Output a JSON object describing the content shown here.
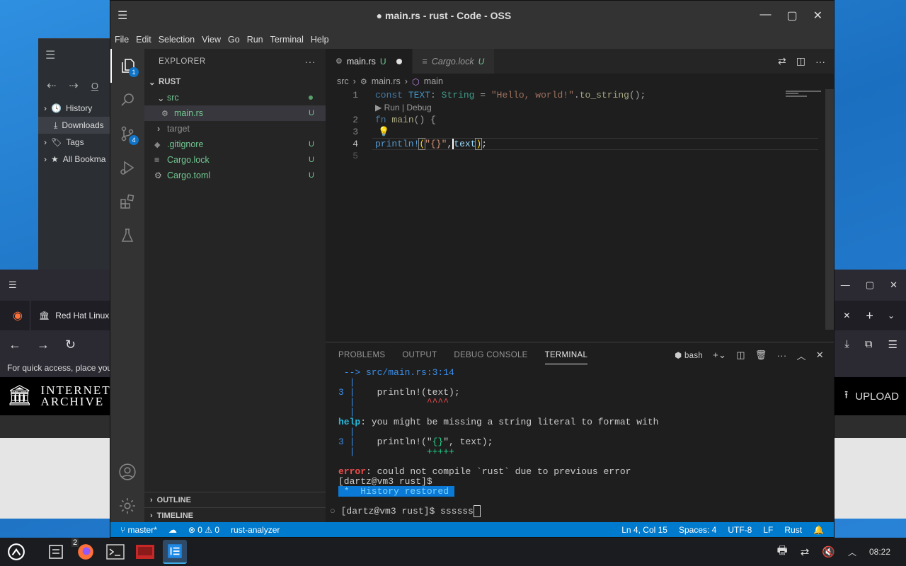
{
  "file_manager": {
    "places": [
      {
        "label": "History",
        "icon": "history-icon"
      },
      {
        "label": "Downloads",
        "icon": "download-icon"
      },
      {
        "label": "Tags",
        "icon": "tag-icon"
      },
      {
        "label": "All Bookma",
        "icon": "star-icon"
      }
    ],
    "nav_letter": "O"
  },
  "firefox": {
    "tab_title": "Red Hat Linux",
    "bookmarks_hint": "For quick access, place you",
    "logo_line1": "INTERNET",
    "logo_line2": "ARCHIVE",
    "upload_label": "UPLOAD"
  },
  "vscode": {
    "title": "main.rs - rust - Code - OSS",
    "menu": [
      "File",
      "Edit",
      "Selection",
      "View",
      "Go",
      "Run",
      "Terminal",
      "Help"
    ],
    "activity_badges": {
      "explorer": "1",
      "scm": "4"
    },
    "explorer": {
      "header": "EXPLORER",
      "more": "···",
      "root": "RUST",
      "items": [
        {
          "label": "src",
          "status": ""
        },
        {
          "label": "main.rs",
          "status": "U"
        },
        {
          "label": "target",
          "status": ""
        },
        {
          "label": ".gitignore",
          "status": "U"
        },
        {
          "label": "Cargo.lock",
          "status": "U"
        },
        {
          "label": "Cargo.toml",
          "status": "U"
        }
      ],
      "outline": "OUTLINE",
      "timeline": "TIMELINE"
    },
    "tabs": [
      {
        "label": "main.rs",
        "status": "U"
      },
      {
        "label": "Cargo.lock",
        "status": "U"
      }
    ],
    "breadcrumb": [
      "src",
      "main.rs",
      "main"
    ],
    "codelens": "▶ Run | Debug",
    "line_numbers": [
      "1",
      "2",
      "3",
      "4",
      "5"
    ],
    "panel_tabs": [
      "PROBLEMS",
      "OUTPUT",
      "DEBUG CONSOLE",
      "TERMINAL"
    ],
    "shell_name": "bash",
    "terminal": {
      "arrow_line": " --> src/main.rs:3:14",
      "pipe": "  |",
      "ln3": "3",
      "err_code": "    println!(text);",
      "err_marks": "             ^^^^",
      "help_label": "help",
      "help_text": ": you might be missing a string literal to format with",
      "fix_code_pre": "    println!(\"",
      "fix_code_braces": "{}",
      "fix_code_post": "\", text);",
      "fix_marks": "             +++++",
      "error_label": "error",
      "error_text": ": could not compile `rust` due to previous error",
      "prompt1": "[dartz@vm3 rust]$",
      "history": " *  History restored ",
      "prompt2": "[dartz@vm3 rust]$ ssssss"
    },
    "status": {
      "branch": "master*",
      "problems": "⊗ 0 ⚠ 0",
      "analyzer": "rust-analyzer",
      "position": "Ln 4, Col 15",
      "spaces": "Spaces: 4",
      "encoding": "UTF-8",
      "eol": "LF",
      "language": "Rust"
    }
  },
  "taskbar": {
    "firefox_count": "2",
    "clock": "08:22"
  }
}
